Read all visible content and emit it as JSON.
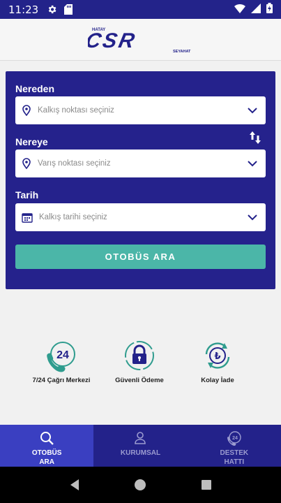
{
  "status_bar": {
    "time": "11:23",
    "icons": [
      "settings-gear-icon",
      "sd-card-icon",
      "wifi-icon",
      "signal-icon",
      "battery-charging-icon"
    ]
  },
  "header": {
    "logo_main": "CSR",
    "logo_top": "HATAY",
    "logo_bottom": "SEYAHAT"
  },
  "search": {
    "from_label": "Nereden",
    "from_placeholder": "Kalkış noktası seçiniz",
    "to_label": "Nereye",
    "to_placeholder": "Varış noktası seçiniz",
    "date_label": "Tarih",
    "date_placeholder": "Kalkış tarihi seçiniz",
    "button_label": "OTOBÜS ARA"
  },
  "features": [
    {
      "label": "7/24 Çağrı Merkezi",
      "icon": "phone-24-icon",
      "badge": "24"
    },
    {
      "label": "Güvenli Ödeme",
      "icon": "padlock-icon"
    },
    {
      "label": "Kolay İade",
      "icon": "lira-refund-icon",
      "symbol": "₺"
    }
  ],
  "bottom_nav": [
    {
      "label": "OTOBÜS ARA",
      "icon": "search-icon",
      "active": true
    },
    {
      "label": "KURUMSAL",
      "icon": "user-icon",
      "active": false
    },
    {
      "label": "DESTEK HATTI",
      "icon": "support-phone-icon",
      "badge": "24",
      "active": false
    }
  ],
  "colors": {
    "primary": "#23228a",
    "card": "#25228c",
    "accent": "#4bb6a8",
    "nav_active": "#3a3fc1",
    "icon_teal": "#2f9c8e"
  }
}
